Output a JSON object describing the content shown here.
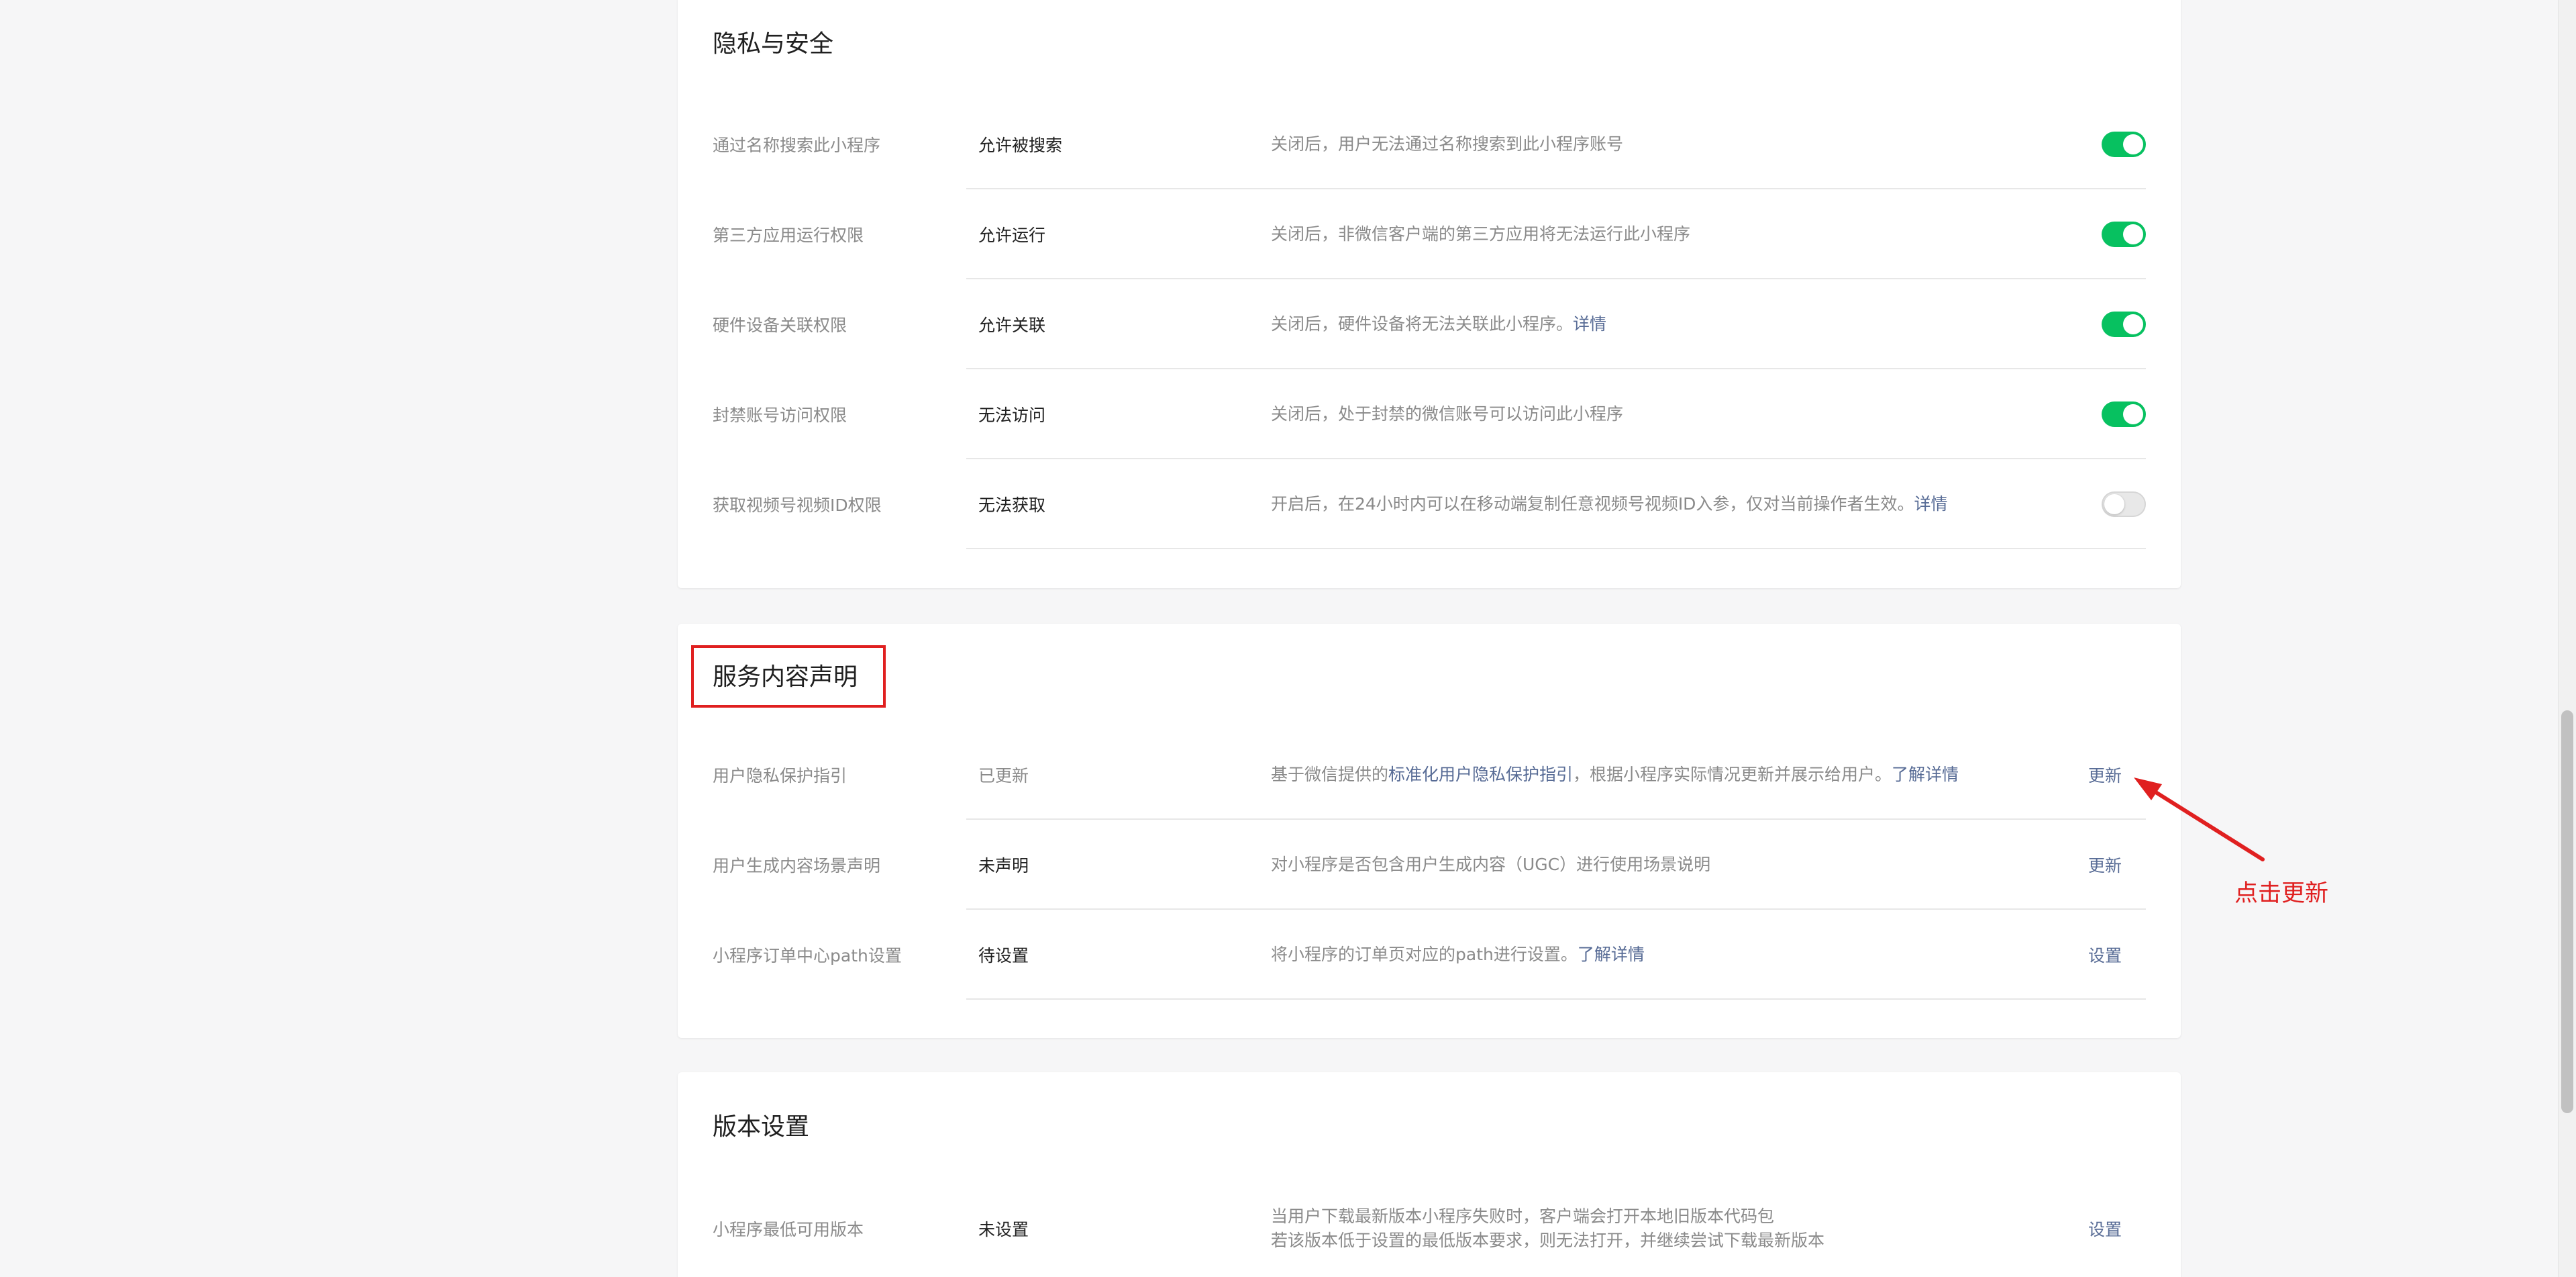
{
  "colors": {
    "accent_link": "#576b95",
    "toggle_on": "#07c160",
    "annotation_red": "#e02020"
  },
  "privacy": {
    "title": "隐私与安全",
    "rows": [
      {
        "label": "通过名称搜索此小程序",
        "value": "允许被搜索",
        "desc": "关闭后，用户无法通过名称搜索到此小程序账号",
        "link": "",
        "toggle_on": true
      },
      {
        "label": "第三方应用运行权限",
        "value": "允许运行",
        "desc": "关闭后，非微信客户端的第三方应用将无法运行此小程序",
        "link": "",
        "toggle_on": true
      },
      {
        "label": "硬件设备关联权限",
        "value": "允许关联",
        "desc": "关闭后，硬件设备将无法关联此小程序。",
        "link": "详情",
        "toggle_on": true
      },
      {
        "label": "封禁账号访问权限",
        "value": "无法访问",
        "desc": "关闭后，处于封禁的微信账号可以访问此小程序",
        "link": "",
        "toggle_on": true
      },
      {
        "label": "获取视频号视频ID权限",
        "value": "无法获取",
        "desc": "开启后，在24小时内可以在移动端复制任意视频号视频ID入参，仅对当前操作者生效。",
        "link": "详情",
        "toggle_on": false
      }
    ]
  },
  "service": {
    "title": "服务内容声明",
    "rows": [
      {
        "label": "用户隐私保护指引",
        "value": "已更新",
        "desc_before": "基于微信提供的",
        "desc_link": "标准化用户隐私保护指引",
        "desc_after": "，根据小程序实际情况更新并展示给用户。",
        "link": "了解详情",
        "action": "更新"
      },
      {
        "label": "用户生成内容场景声明",
        "value": "未声明",
        "desc": "对小程序是否包含用户生成内容（UGC）进行使用场景说明",
        "action": "更新"
      },
      {
        "label": "小程序订单中心path设置",
        "value": "待设置",
        "desc": "将小程序的订单页对应的path进行设置。",
        "link": "了解详情",
        "action": "设置"
      }
    ]
  },
  "version": {
    "title": "版本设置",
    "rows": [
      {
        "label": "小程序最低可用版本",
        "value": "未设置",
        "desc_line1": "当用户下载最新版本小程序失败时，客户端会打开本地旧版本代码包",
        "desc_line2": "若该版本低于设置的最低版本要求，则无法打开，并继续尝试下载最新版本",
        "action": "设置"
      }
    ]
  },
  "annotation": {
    "text": "点击更新"
  }
}
